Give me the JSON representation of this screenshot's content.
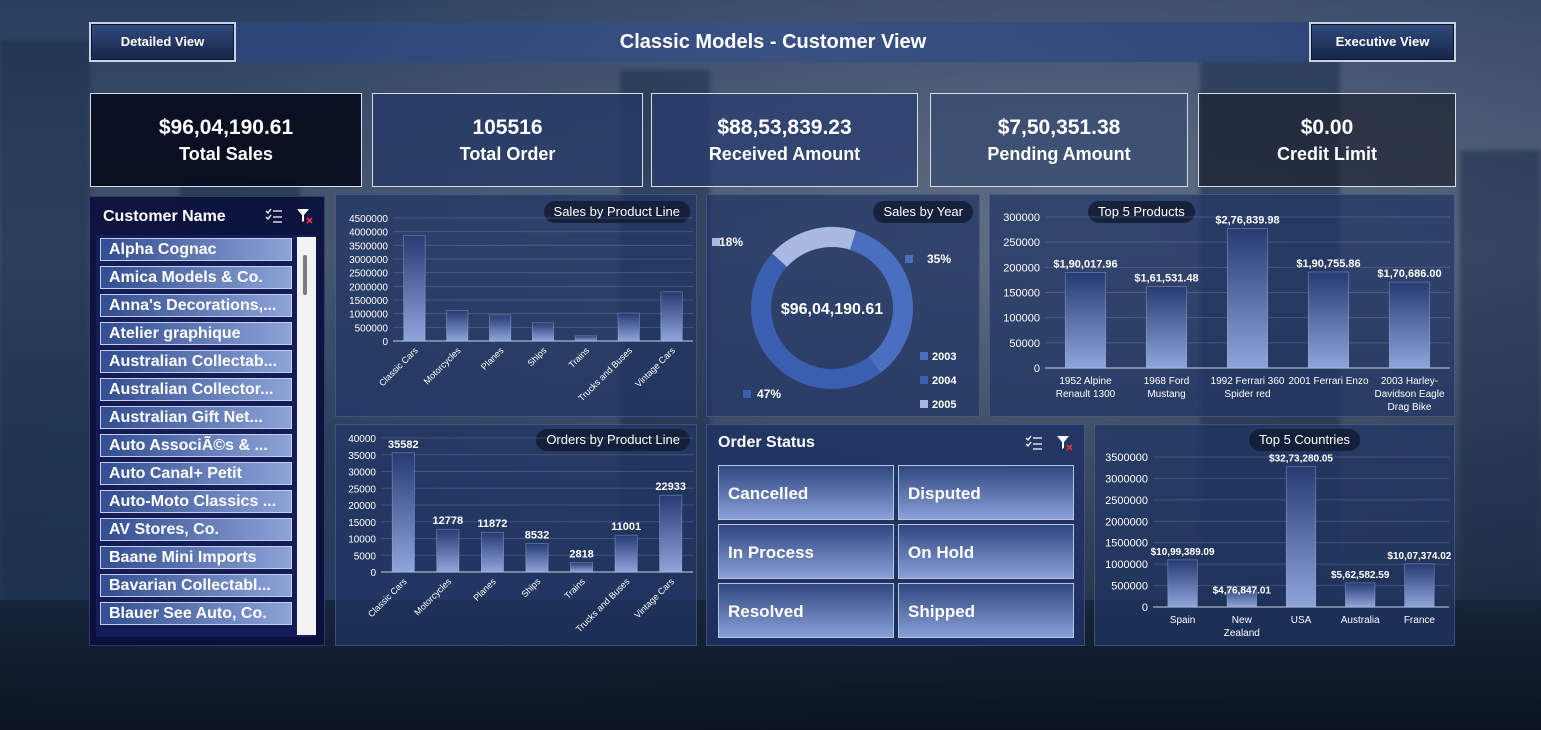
{
  "header": {
    "title": "Classic Models - Customer View",
    "detailed_btn": "Detailed View",
    "executive_btn": "Executive View"
  },
  "kpis": [
    {
      "value": "$96,04,190.61",
      "label": "Total Sales"
    },
    {
      "value": "105516",
      "label": "Total Order"
    },
    {
      "value": "$88,53,839.23",
      "label": "Received Amount"
    },
    {
      "value": "$7,50,351.38",
      "label": "Pending Amount"
    },
    {
      "value": "$0.00",
      "label": "Credit Limit"
    }
  ],
  "customer_slicer": {
    "title": "Customer Name",
    "items": [
      "Alpha Cognac",
      "Amica Models & Co.",
      "Anna's Decorations,...",
      "Atelier graphique",
      "Australian Collectab...",
      "Australian Collector...",
      "Australian Gift Net...",
      "Auto AssociÃ©s & ...",
      "Auto Canal+ Petit",
      "Auto-Moto Classics ...",
      "AV Stores, Co.",
      "Baane Mini Imports",
      "Bavarian Collectabl...",
      "Blauer See Auto, Co."
    ]
  },
  "order_status": {
    "title": "Order Status",
    "items": [
      "Cancelled",
      "Disputed",
      "In Process",
      "On Hold",
      "Resolved",
      "Shipped"
    ]
  },
  "colors": {
    "bar_top": "#263b73",
    "bar_bottom": "#8fa6dc",
    "donut_2003": "#4a6fbf",
    "donut_2004": "#3a5fb0",
    "donut_2005": "#a9b9e0"
  },
  "chart_data": [
    {
      "id": "sales_by_product_line",
      "type": "bar",
      "title": "Sales by Product Line",
      "categories": [
        "Classic Cars",
        "Motorcycles",
        "Planes",
        "Ships",
        "Trains",
        "Trucks and Buses",
        "Vintage Cars"
      ],
      "values": [
        3853922,
        1121426,
        954638,
        663998,
        188532,
        1024113,
        1797560
      ],
      "ylim": [
        0,
        4500000
      ],
      "yticks": [
        "0",
        "500000",
        "1000000",
        "1500000",
        "2000000",
        "2500000",
        "3000000",
        "3500000",
        "4000000",
        "4500000"
      ]
    },
    {
      "id": "sales_by_year",
      "type": "pie",
      "title": "Sales by Year",
      "center_label": "$96,04,190.61",
      "categories": [
        "2003",
        "2004",
        "2005"
      ],
      "values": [
        35,
        47,
        18
      ],
      "labels": [
        "35%",
        "47%",
        "18%"
      ]
    },
    {
      "id": "top5_products",
      "type": "bar",
      "title": "Top 5 Products",
      "categories": [
        "1952 Alpine Renault 1300",
        "1968 Ford Mustang",
        "1992 Ferrari 360 Spider red",
        "2001 Ferrari Enzo",
        "2003 Harley-Davidson Eagle Drag Bike"
      ],
      "category_lines": [
        [
          "1952 Alpine",
          "Renault 1300"
        ],
        [
          "1968 Ford",
          "Mustang"
        ],
        [
          "1992 Ferrari 360",
          "Spider red"
        ],
        [
          "2001 Ferrari Enzo"
        ],
        [
          "2003 Harley-",
          "Davidson Eagle",
          "Drag Bike"
        ]
      ],
      "values": [
        190017.96,
        161531.48,
        276839.98,
        190755.86,
        170686.0
      ],
      "data_labels": [
        "$1,90,017.96",
        "$1,61,531.48",
        "$2,76,839.98",
        "$1,90,755.86",
        "$1,70,686.00"
      ],
      "ylim": [
        0,
        300000
      ],
      "yticks": [
        "0",
        "50000",
        "100000",
        "150000",
        "200000",
        "250000",
        "300000"
      ]
    },
    {
      "id": "orders_by_product_line",
      "type": "bar",
      "title": "Orders by Product Line",
      "categories": [
        "Classic Cars",
        "Motorcycles",
        "Planes",
        "Ships",
        "Trains",
        "Trucks and Buses",
        "Vintage Cars"
      ],
      "values": [
        35582,
        12778,
        11872,
        8532,
        2818,
        11001,
        22933
      ],
      "data_labels": [
        "35582",
        "12778",
        "11872",
        "8532",
        "2818",
        "11001",
        "22933"
      ],
      "ylim": [
        0,
        40000
      ],
      "yticks": [
        "0",
        "5000",
        "10000",
        "15000",
        "20000",
        "25000",
        "30000",
        "35000",
        "40000"
      ]
    },
    {
      "id": "top5_countries",
      "type": "bar",
      "title": "Top 5 Countries",
      "categories": [
        "Spain",
        "New Zealand",
        "USA",
        "Australia",
        "France"
      ],
      "category_lines": [
        [
          "Spain"
        ],
        [
          "New",
          "Zealand"
        ],
        [
          "USA"
        ],
        [
          "Australia"
        ],
        [
          "France"
        ]
      ],
      "values": [
        1099389.09,
        476847.01,
        3273280.05,
        562582.59,
        1007374.02
      ],
      "data_labels": [
        "$10,99,389.09",
        "$4,76,847.01",
        "$32,73,280.05",
        "$5,62,582.59",
        "$10,07,374.02"
      ],
      "ylim": [
        0,
        3500000
      ],
      "yticks": [
        "0",
        "500000",
        "1000000",
        "1500000",
        "2000000",
        "2500000",
        "3000000",
        "3500000"
      ]
    }
  ]
}
